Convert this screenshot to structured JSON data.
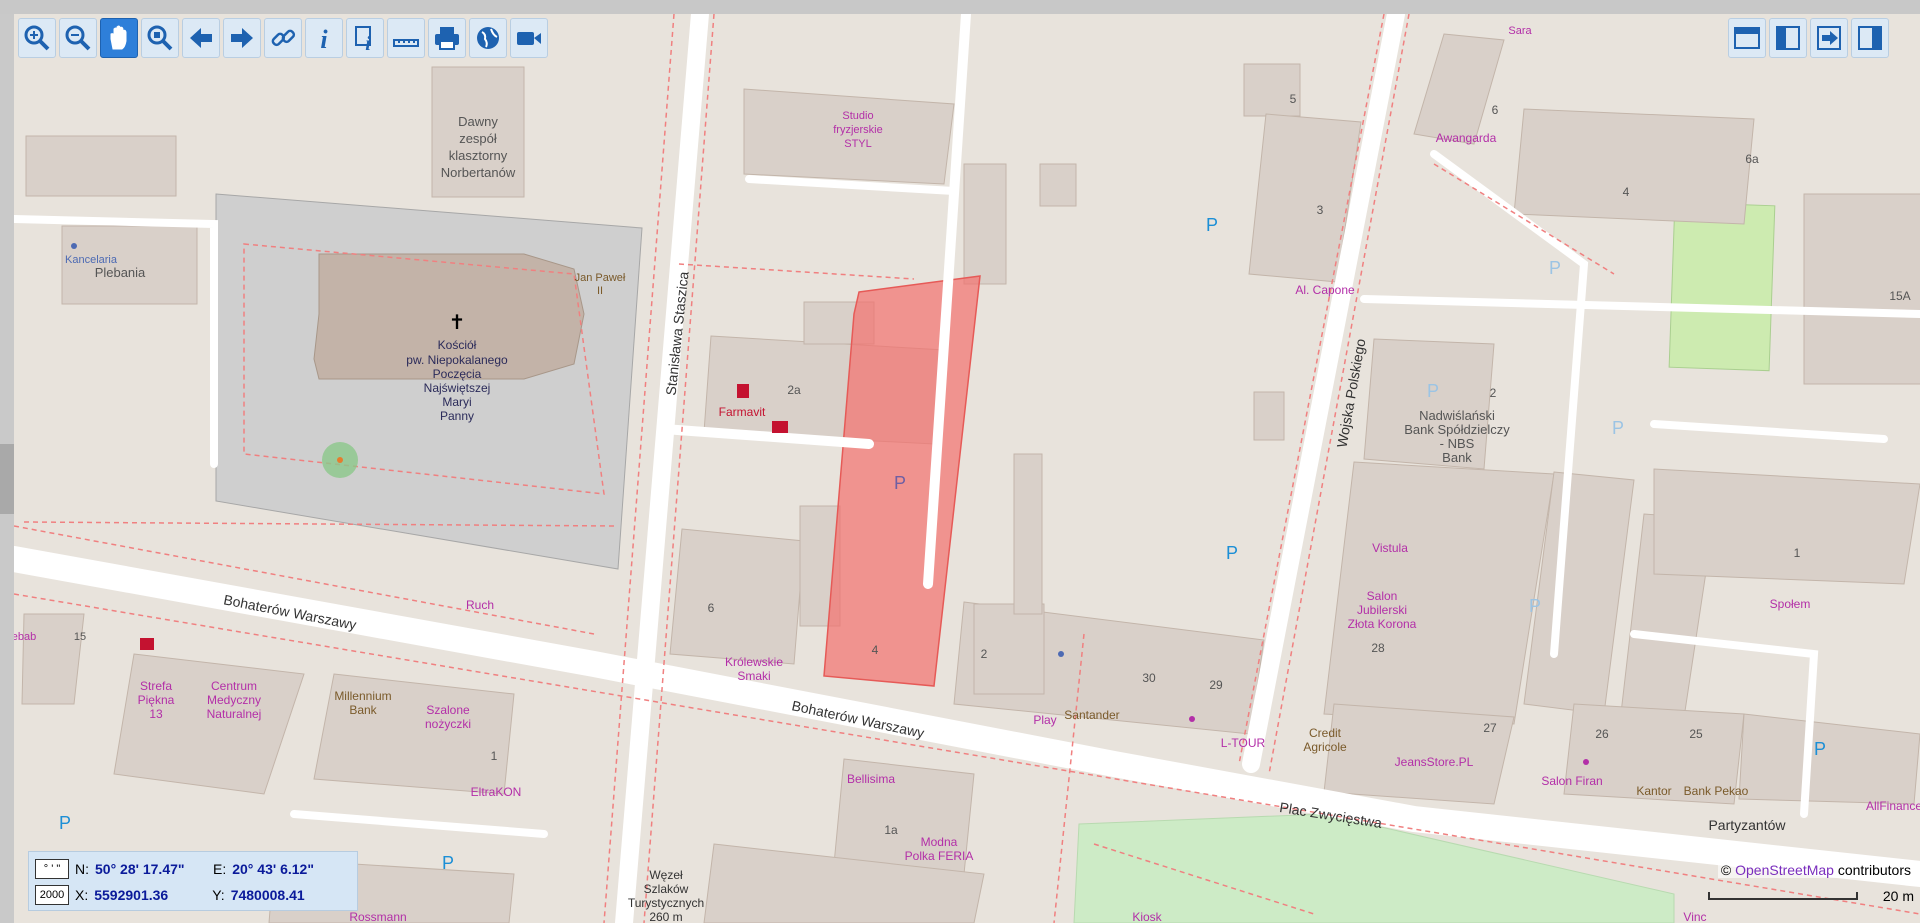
{
  "toolbar": {
    "tools": [
      {
        "name": "zoom-in-icon"
      },
      {
        "name": "zoom-out-icon"
      },
      {
        "name": "pan-icon",
        "active": true
      },
      {
        "name": "zoom-extent-icon"
      },
      {
        "name": "back-arrow-icon"
      },
      {
        "name": "forward-arrow-icon"
      },
      {
        "name": "link-icon"
      },
      {
        "name": "info-icon"
      },
      {
        "name": "info-document-icon"
      },
      {
        "name": "measure-ruler-icon"
      },
      {
        "name": "print-icon"
      },
      {
        "name": "globe-icon"
      },
      {
        "name": "video-camera-icon"
      }
    ],
    "right_tools": [
      {
        "name": "window-top-icon"
      },
      {
        "name": "panel-left-icon"
      },
      {
        "name": "export-icon"
      },
      {
        "name": "panel-right-icon"
      }
    ],
    "accent": "#2e7fd9"
  },
  "map": {
    "labels": {
      "norbertanow": [
        "Dawny",
        "zespół",
        "klasztorny",
        "Norbertanów"
      ],
      "kancelaria": "Kancelaria",
      "plebania": "Plebania",
      "jan_pawel": [
        "Jan Paweł",
        "II"
      ],
      "kosciol": [
        "Kościół",
        "pw. Niepokalanego",
        "Poczęcia",
        "Najświętszej",
        "Maryi",
        "Panny"
      ],
      "staszica": "Stanisława Staszica",
      "studio": [
        "Studio",
        "fryzjerskie",
        "STYL"
      ],
      "farmavit": "Farmavit",
      "n2a": "2a",
      "parking": "P",
      "n5": "5",
      "n3": "3",
      "alcapone": "Al. Capone",
      "wojska": "Wojska Polskiego",
      "n6": "6",
      "awangarda": "Awangarda",
      "sara": "Sara",
      "n6a": "6a",
      "n4": "4",
      "n15a": "15A",
      "nbs": [
        "Nadwiślański",
        "Bank Spółdzielczy",
        "- NBS",
        "Bank"
      ],
      "n2": "2",
      "vistula": "Vistula",
      "salon": [
        "Salon",
        "Jubilerski",
        "Złota Korona"
      ],
      "n28": "28",
      "n1": "1",
      "spolem": "Społem",
      "ruch": "Ruch",
      "n6b": "6",
      "krolewskie": [
        "Królewskie",
        "Smaki"
      ],
      "bohaterow1": "Bohaterów Warszawy",
      "bohaterow2": "Bohaterów Warszawy",
      "kebab": "ebab",
      "n15": "15",
      "strefa": [
        "Strefa",
        "Piękna",
        "13"
      ],
      "centrum": [
        "Centrum",
        "Medyczny",
        "Naturalnej"
      ],
      "millennium": [
        "Millennium",
        "Bank"
      ],
      "szalone": [
        "Szalone",
        "nożyczki"
      ],
      "eltrakon": "EltraKON",
      "n1b": "1",
      "n30": "30",
      "n29": "29",
      "play": "Play",
      "santander": "Santander",
      "ltour": "L-TOUR",
      "credit": [
        "Credit",
        "Agricole"
      ],
      "jeans": "JeansStore.PL",
      "n27": "27",
      "n26": "26",
      "n25": "25",
      "salonfiran": "Salon Firan",
      "kantor": "Kantor",
      "bankpekao": "Bank Pekao",
      "plac": "Plac Zwycięstwa",
      "partyzantow": "Partyzantów",
      "allfinance": "AllFinance",
      "bellisima": "Bellisima",
      "n1a": "1a",
      "modna": [
        "Modna",
        "Polka FERIA"
      ],
      "wezel": [
        "Węzeł",
        "Szlaków",
        "Turystycznych",
        "260 m"
      ],
      "kiosk": "Kiosk",
      "rossmann": "Rossmann",
      "vinc": "Vinc"
    }
  },
  "coords": {
    "format_icon": "° ' \"",
    "system": "2000",
    "n_label": "N:",
    "n_value": "50° 28' 17.47\"",
    "e_label": "E:",
    "e_value": "20° 43' 6.12\"",
    "x_label": "X:",
    "x_value": "5592901.36",
    "y_label": "Y:",
    "y_value": "7480008.41"
  },
  "attribution": {
    "prefix": "© ",
    "link": "OpenStreetMap",
    "suffix": " contributors"
  },
  "scale": {
    "label": "20 m"
  }
}
